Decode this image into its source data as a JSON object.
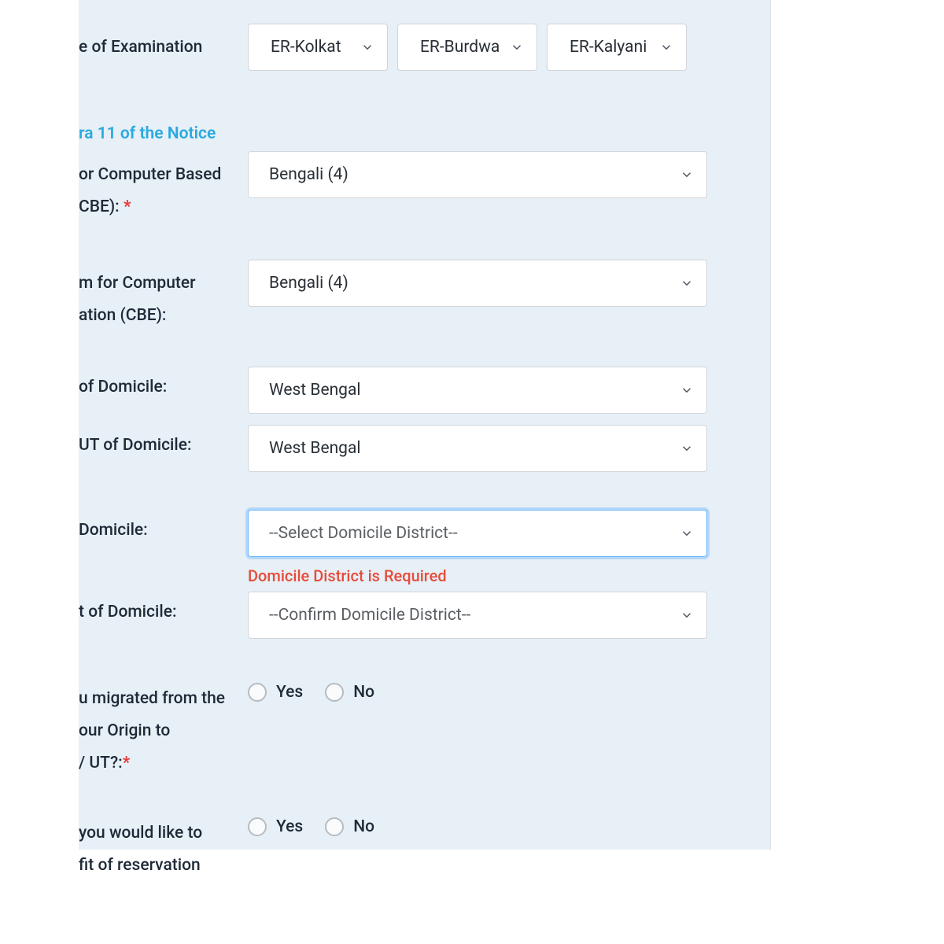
{
  "exam_centre": {
    "label": "e of Examination",
    "options": [
      "ER-Kolkat",
      "ER-Burdwa",
      "ER-Kalyani"
    ]
  },
  "notice_link": "ra 11 of the Notice",
  "cbe_medium": {
    "label_line1": "or Computer Based",
    "label_line2": "CBE): ",
    "value": "Bengali (4)"
  },
  "cbe_confirm": {
    "label_line1": "m for Computer",
    "label_line2": "ation (CBE):",
    "value": "Bengali (4)"
  },
  "domicile_state": {
    "label": "of Domicile:",
    "value": "West Bengal"
  },
  "domicile_state_confirm": {
    "label": "UT of Domicile:",
    "value": "West Bengal"
  },
  "domicile_district": {
    "label": " Domicile:",
    "placeholder": "--Select Domicile District--",
    "error": "Domicile District is Required"
  },
  "domicile_district_confirm": {
    "label": "t of Domicile:",
    "placeholder": "--Confirm Domicile District--"
  },
  "migrated": {
    "label_line1": "u migrated from the",
    "label_line2": "our Origin to",
    "label_line3": "/ UT?:",
    "yes": "Yes",
    "no": "No"
  },
  "reservation": {
    "label_line1": " you would like to",
    "label_line2": "fit of reservation",
    "yes": "Yes",
    "no": "No"
  }
}
